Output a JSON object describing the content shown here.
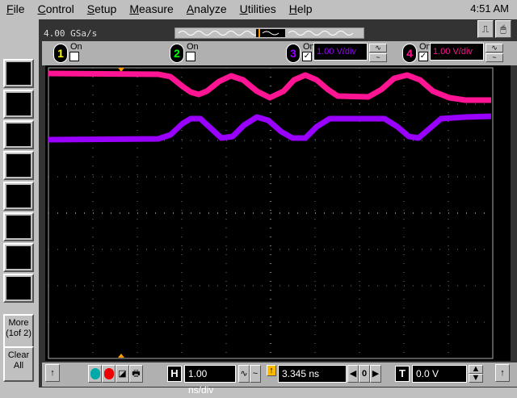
{
  "menu": [
    "File",
    "Control",
    "Setup",
    "Measure",
    "Analyze",
    "Utilities",
    "Help"
  ],
  "clock": "4:51 AM",
  "sample_rate": "4.00 GSa/s",
  "channels": [
    {
      "num": "1",
      "on_label": "On",
      "on": false,
      "color": "#ffff00"
    },
    {
      "num": "2",
      "on_label": "On",
      "on": false,
      "color": "#00ff00"
    },
    {
      "num": "3",
      "on_label": "On",
      "on": true,
      "color": "#9900ff",
      "scale": "1.00 V/div"
    },
    {
      "num": "4",
      "on_label": "On",
      "on": true,
      "color": "#ff1493",
      "scale": "1.00 V/div"
    }
  ],
  "left_panel": {
    "more": "More (1of 2)",
    "clear": "Clear All"
  },
  "bottom": {
    "timebase": "1.00 ns/div",
    "h_label": "H",
    "delay": "3.345 ns",
    "zero": "0",
    "t_label": "T",
    "trigger_level": "0.0 V"
  }
}
